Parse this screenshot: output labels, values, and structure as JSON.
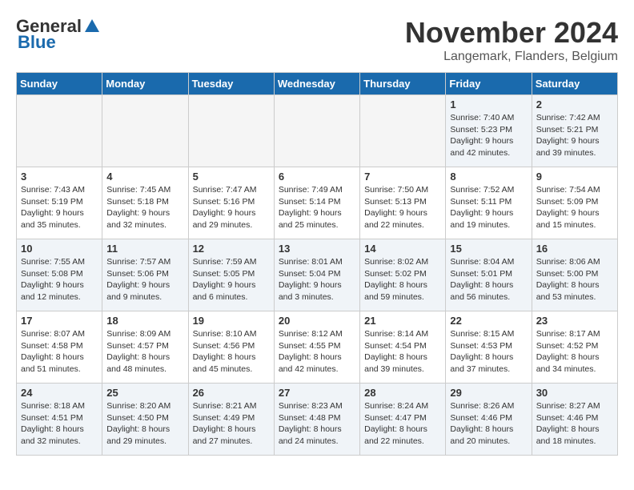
{
  "logo": {
    "general": "General",
    "blue": "Blue"
  },
  "title": {
    "month": "November 2024",
    "location": "Langemark, Flanders, Belgium"
  },
  "weekdays": [
    "Sunday",
    "Monday",
    "Tuesday",
    "Wednesday",
    "Thursday",
    "Friday",
    "Saturday"
  ],
  "weeks": [
    [
      {
        "day": "",
        "empty": true
      },
      {
        "day": "",
        "empty": true
      },
      {
        "day": "",
        "empty": true
      },
      {
        "day": "",
        "empty": true
      },
      {
        "day": "",
        "empty": true
      },
      {
        "day": "1",
        "sunrise": "Sunrise: 7:40 AM",
        "sunset": "Sunset: 5:23 PM",
        "daylight": "Daylight: 9 hours and 42 minutes."
      },
      {
        "day": "2",
        "sunrise": "Sunrise: 7:42 AM",
        "sunset": "Sunset: 5:21 PM",
        "daylight": "Daylight: 9 hours and 39 minutes."
      }
    ],
    [
      {
        "day": "3",
        "sunrise": "Sunrise: 7:43 AM",
        "sunset": "Sunset: 5:19 PM",
        "daylight": "Daylight: 9 hours and 35 minutes."
      },
      {
        "day": "4",
        "sunrise": "Sunrise: 7:45 AM",
        "sunset": "Sunset: 5:18 PM",
        "daylight": "Daylight: 9 hours and 32 minutes."
      },
      {
        "day": "5",
        "sunrise": "Sunrise: 7:47 AM",
        "sunset": "Sunset: 5:16 PM",
        "daylight": "Daylight: 9 hours and 29 minutes."
      },
      {
        "day": "6",
        "sunrise": "Sunrise: 7:49 AM",
        "sunset": "Sunset: 5:14 PM",
        "daylight": "Daylight: 9 hours and 25 minutes."
      },
      {
        "day": "7",
        "sunrise": "Sunrise: 7:50 AM",
        "sunset": "Sunset: 5:13 PM",
        "daylight": "Daylight: 9 hours and 22 minutes."
      },
      {
        "day": "8",
        "sunrise": "Sunrise: 7:52 AM",
        "sunset": "Sunset: 5:11 PM",
        "daylight": "Daylight: 9 hours and 19 minutes."
      },
      {
        "day": "9",
        "sunrise": "Sunrise: 7:54 AM",
        "sunset": "Sunset: 5:09 PM",
        "daylight": "Daylight: 9 hours and 15 minutes."
      }
    ],
    [
      {
        "day": "10",
        "sunrise": "Sunrise: 7:55 AM",
        "sunset": "Sunset: 5:08 PM",
        "daylight": "Daylight: 9 hours and 12 minutes."
      },
      {
        "day": "11",
        "sunrise": "Sunrise: 7:57 AM",
        "sunset": "Sunset: 5:06 PM",
        "daylight": "Daylight: 9 hours and 9 minutes."
      },
      {
        "day": "12",
        "sunrise": "Sunrise: 7:59 AM",
        "sunset": "Sunset: 5:05 PM",
        "daylight": "Daylight: 9 hours and 6 minutes."
      },
      {
        "day": "13",
        "sunrise": "Sunrise: 8:01 AM",
        "sunset": "Sunset: 5:04 PM",
        "daylight": "Daylight: 9 hours and 3 minutes."
      },
      {
        "day": "14",
        "sunrise": "Sunrise: 8:02 AM",
        "sunset": "Sunset: 5:02 PM",
        "daylight": "Daylight: 8 hours and 59 minutes."
      },
      {
        "day": "15",
        "sunrise": "Sunrise: 8:04 AM",
        "sunset": "Sunset: 5:01 PM",
        "daylight": "Daylight: 8 hours and 56 minutes."
      },
      {
        "day": "16",
        "sunrise": "Sunrise: 8:06 AM",
        "sunset": "Sunset: 5:00 PM",
        "daylight": "Daylight: 8 hours and 53 minutes."
      }
    ],
    [
      {
        "day": "17",
        "sunrise": "Sunrise: 8:07 AM",
        "sunset": "Sunset: 4:58 PM",
        "daylight": "Daylight: 8 hours and 51 minutes."
      },
      {
        "day": "18",
        "sunrise": "Sunrise: 8:09 AM",
        "sunset": "Sunset: 4:57 PM",
        "daylight": "Daylight: 8 hours and 48 minutes."
      },
      {
        "day": "19",
        "sunrise": "Sunrise: 8:10 AM",
        "sunset": "Sunset: 4:56 PM",
        "daylight": "Daylight: 8 hours and 45 minutes."
      },
      {
        "day": "20",
        "sunrise": "Sunrise: 8:12 AM",
        "sunset": "Sunset: 4:55 PM",
        "daylight": "Daylight: 8 hours and 42 minutes."
      },
      {
        "day": "21",
        "sunrise": "Sunrise: 8:14 AM",
        "sunset": "Sunset: 4:54 PM",
        "daylight": "Daylight: 8 hours and 39 minutes."
      },
      {
        "day": "22",
        "sunrise": "Sunrise: 8:15 AM",
        "sunset": "Sunset: 4:53 PM",
        "daylight": "Daylight: 8 hours and 37 minutes."
      },
      {
        "day": "23",
        "sunrise": "Sunrise: 8:17 AM",
        "sunset": "Sunset: 4:52 PM",
        "daylight": "Daylight: 8 hours and 34 minutes."
      }
    ],
    [
      {
        "day": "24",
        "sunrise": "Sunrise: 8:18 AM",
        "sunset": "Sunset: 4:51 PM",
        "daylight": "Daylight: 8 hours and 32 minutes."
      },
      {
        "day": "25",
        "sunrise": "Sunrise: 8:20 AM",
        "sunset": "Sunset: 4:50 PM",
        "daylight": "Daylight: 8 hours and 29 minutes."
      },
      {
        "day": "26",
        "sunrise": "Sunrise: 8:21 AM",
        "sunset": "Sunset: 4:49 PM",
        "daylight": "Daylight: 8 hours and 27 minutes."
      },
      {
        "day": "27",
        "sunrise": "Sunrise: 8:23 AM",
        "sunset": "Sunset: 4:48 PM",
        "daylight": "Daylight: 8 hours and 24 minutes."
      },
      {
        "day": "28",
        "sunrise": "Sunrise: 8:24 AM",
        "sunset": "Sunset: 4:47 PM",
        "daylight": "Daylight: 8 hours and 22 minutes."
      },
      {
        "day": "29",
        "sunrise": "Sunrise: 8:26 AM",
        "sunset": "Sunset: 4:46 PM",
        "daylight": "Daylight: 8 hours and 20 minutes."
      },
      {
        "day": "30",
        "sunrise": "Sunrise: 8:27 AM",
        "sunset": "Sunset: 4:46 PM",
        "daylight": "Daylight: 8 hours and 18 minutes."
      }
    ]
  ]
}
